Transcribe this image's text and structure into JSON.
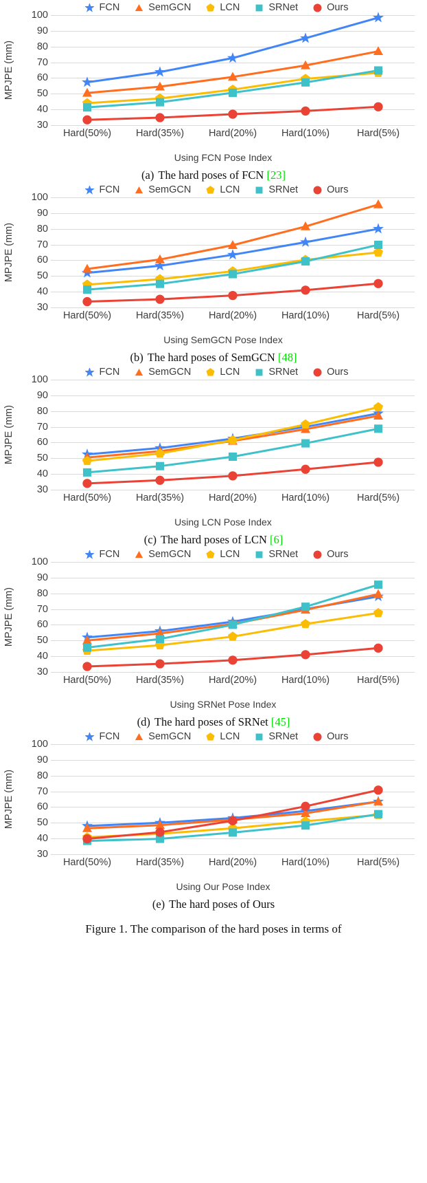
{
  "legend": {
    "items": [
      {
        "label": "FCN",
        "marker": "star-marker-icon",
        "color": "#4285f4"
      },
      {
        "label": "SemGCN",
        "marker": "triangle-marker-icon",
        "color": "#ff6d1f"
      },
      {
        "label": "LCN",
        "marker": "pentagon-marker-icon",
        "color": "#fbbc04"
      },
      {
        "label": "SRNet",
        "marker": "square-marker-icon",
        "color": "#3fc1c9"
      },
      {
        "label": "Ours",
        "marker": "circle-marker-icon",
        "color": "#ea4335"
      }
    ]
  },
  "axis": {
    "ylabel": "MPJPE (mm)",
    "yticks": [
      "100",
      "90",
      "80",
      "70",
      "60",
      "50",
      "40",
      "30"
    ],
    "xticks": [
      "Hard(50%)",
      "Hard(35%)",
      "Hard(20%)",
      "Hard(10%)",
      "Hard(5%)"
    ]
  },
  "panels": [
    {
      "id": "a",
      "xaxis_title": "Using FCN Pose Index",
      "caption_label": "(a)",
      "caption_text": "The hard poses of FCN",
      "caption_cite": "[23]"
    },
    {
      "id": "b",
      "xaxis_title": "Using SemGCN Pose Index",
      "caption_label": "(b)",
      "caption_text": "The hard poses of SemGCN",
      "caption_cite": "[48]"
    },
    {
      "id": "c",
      "xaxis_title": "Using LCN Pose Index",
      "caption_label": "(c)",
      "caption_text": "The hard poses of LCN",
      "caption_cite": "[6]"
    },
    {
      "id": "d",
      "xaxis_title": "Using SRNet Pose Index",
      "caption_label": "(d)",
      "caption_text": "The hard poses of SRNet",
      "caption_cite": "[45]"
    },
    {
      "id": "e",
      "xaxis_title": "Using Our Pose Index",
      "caption_label": "(e)",
      "caption_text": "The hard poses of Ours",
      "caption_cite": ""
    }
  ],
  "figure_caption": "Figure 1.  The comparison of the hard poses in terms of",
  "chart_data": [
    {
      "type": "line",
      "id": "a",
      "title": "(a) The hard poses of FCN [23]",
      "xlabel": "Using FCN Pose Index",
      "ylabel": "MPJPE (mm)",
      "categories": [
        "Hard(50%)",
        "Hard(35%)",
        "Hard(20%)",
        "Hard(10%)",
        "Hard(5%)"
      ],
      "ylim": [
        30,
        100
      ],
      "ytick_values": [
        30,
        40,
        50,
        60,
        70,
        80,
        90,
        100
      ],
      "grid": true,
      "legend_position": "top",
      "series": [
        {
          "name": "FCN",
          "color": "#4285f4",
          "marker": "star",
          "values": [
            57.3,
            63.8,
            72.7,
            85.3,
            98.4
          ]
        },
        {
          "name": "SemGCN",
          "color": "#ff6d1f",
          "marker": "triangle",
          "values": [
            50.5,
            54.5,
            60.7,
            68.0,
            77.0
          ]
        },
        {
          "name": "LCN",
          "color": "#fbbc04",
          "marker": "pentagon",
          "values": [
            44.0,
            47.0,
            52.6,
            59.5,
            63.3
          ]
        },
        {
          "name": "SRNet",
          "color": "#3fc1c9",
          "marker": "square",
          "values": [
            41.3,
            44.6,
            50.6,
            57.2,
            64.8
          ]
        },
        {
          "name": "Ours",
          "color": "#ea4335",
          "marker": "circle",
          "values": [
            33.4,
            34.8,
            37.0,
            39.0,
            41.7
          ]
        }
      ]
    },
    {
      "type": "line",
      "id": "b",
      "title": "(b) The hard poses of SemGCN [48]",
      "xlabel": "Using SemGCN Pose Index",
      "ylabel": "MPJPE (mm)",
      "categories": [
        "Hard(50%)",
        "Hard(35%)",
        "Hard(20%)",
        "Hard(10%)",
        "Hard(5%)"
      ],
      "ylim": [
        30,
        100
      ],
      "ytick_values": [
        30,
        40,
        50,
        60,
        70,
        80,
        90,
        100
      ],
      "grid": true,
      "legend_position": "top",
      "series": [
        {
          "name": "FCN",
          "color": "#4285f4",
          "marker": "star",
          "values": [
            52.0,
            56.5,
            63.5,
            71.5,
            80.0
          ]
        },
        {
          "name": "SemGCN",
          "color": "#ff6d1f",
          "marker": "triangle",
          "values": [
            54.5,
            60.5,
            69.6,
            81.5,
            95.5
          ]
        },
        {
          "name": "LCN",
          "color": "#fbbc04",
          "marker": "pentagon",
          "values": [
            44.5,
            48.0,
            53.0,
            60.3,
            65.0
          ]
        },
        {
          "name": "SRNet",
          "color": "#3fc1c9",
          "marker": "square",
          "values": [
            41.3,
            45.0,
            51.2,
            59.3,
            69.8
          ]
        },
        {
          "name": "Ours",
          "color": "#ea4335",
          "marker": "circle",
          "values": [
            33.7,
            35.2,
            37.6,
            41.0,
            45.2
          ]
        }
      ]
    },
    {
      "type": "line",
      "id": "c",
      "title": "(c) The hard poses of LCN [6]",
      "xlabel": "Using LCN Pose Index",
      "ylabel": "MPJPE (mm)",
      "categories": [
        "Hard(50%)",
        "Hard(35%)",
        "Hard(20%)",
        "Hard(10%)",
        "Hard(5%)"
      ],
      "ylim": [
        30,
        100
      ],
      "ytick_values": [
        30,
        40,
        50,
        60,
        70,
        80,
        90,
        100
      ],
      "grid": true,
      "legend_position": "top",
      "series": [
        {
          "name": "FCN",
          "color": "#4285f4",
          "marker": "star",
          "values": [
            52.5,
            56.5,
            62.5,
            70.0,
            78.5
          ]
        },
        {
          "name": "SemGCN",
          "color": "#ff6d1f",
          "marker": "triangle",
          "values": [
            50.5,
            54.5,
            61.0,
            68.5,
            77.0
          ]
        },
        {
          "name": "LCN",
          "color": "#fbbc04",
          "marker": "pentagon",
          "values": [
            48.3,
            53.0,
            61.5,
            71.5,
            82.5
          ]
        },
        {
          "name": "SRNet",
          "color": "#3fc1c9",
          "marker": "square",
          "values": [
            41.0,
            45.0,
            51.0,
            59.5,
            68.8
          ]
        },
        {
          "name": "Ours",
          "color": "#ea4335",
          "marker": "circle",
          "values": [
            34.0,
            36.0,
            38.8,
            43.0,
            47.5
          ]
        }
      ]
    },
    {
      "type": "line",
      "id": "d",
      "title": "(d) The hard poses of SRNet [45]",
      "xlabel": "Using SRNet Pose Index",
      "ylabel": "MPJPE (mm)",
      "categories": [
        "Hard(50%)",
        "Hard(35%)",
        "Hard(20%)",
        "Hard(10%)",
        "Hard(5%)"
      ],
      "ylim": [
        30,
        100
      ],
      "ytick_values": [
        30,
        40,
        50,
        60,
        70,
        80,
        90,
        100
      ],
      "grid": true,
      "legend_position": "top",
      "series": [
        {
          "name": "FCN",
          "color": "#4285f4",
          "marker": "star",
          "values": [
            52.0,
            56.0,
            62.0,
            70.0,
            78.0
          ]
        },
        {
          "name": "SemGCN",
          "color": "#ff6d1f",
          "marker": "triangle",
          "values": [
            50.0,
            54.5,
            60.5,
            69.5,
            79.5
          ]
        },
        {
          "name": "LCN",
          "color": "#fbbc04",
          "marker": "pentagon",
          "values": [
            43.5,
            47.0,
            52.5,
            60.5,
            67.5
          ]
        },
        {
          "name": "SRNet",
          "color": "#3fc1c9",
          "marker": "square",
          "values": [
            45.5,
            51.0,
            60.0,
            71.5,
            85.5
          ]
        },
        {
          "name": "Ours",
          "color": "#ea4335",
          "marker": "circle",
          "values": [
            33.5,
            35.2,
            37.5,
            41.0,
            45.2
          ]
        }
      ]
    },
    {
      "type": "line",
      "id": "e",
      "title": "(e) The hard poses of Ours",
      "xlabel": "Using Our Pose Index",
      "ylabel": "MPJPE (mm)",
      "categories": [
        "Hard(50%)",
        "Hard(35%)",
        "Hard(20%)",
        "Hard(10%)",
        "Hard(5%)"
      ],
      "ylim": [
        30,
        100
      ],
      "ytick_values": [
        30,
        40,
        50,
        60,
        70,
        80,
        90,
        100
      ],
      "grid": true,
      "legend_position": "top",
      "series": [
        {
          "name": "FCN",
          "color": "#4285f4",
          "marker": "star",
          "values": [
            48.0,
            50.0,
            53.0,
            57.5,
            63.5
          ]
        },
        {
          "name": "SemGCN",
          "color": "#ff6d1f",
          "marker": "triangle",
          "values": [
            46.5,
            48.5,
            52.0,
            56.0,
            63.5
          ]
        },
        {
          "name": "LCN",
          "color": "#fbbc04",
          "marker": "pentagon",
          "values": [
            40.8,
            43.0,
            46.5,
            51.0,
            55.0
          ]
        },
        {
          "name": "SRNet",
          "color": "#3fc1c9",
          "marker": "square",
          "values": [
            38.5,
            39.8,
            43.8,
            48.3,
            55.5
          ]
        },
        {
          "name": "Ours",
          "color": "#ea4335",
          "marker": "circle",
          "values": [
            39.8,
            44.0,
            51.3,
            60.5,
            70.8
          ]
        }
      ]
    }
  ]
}
